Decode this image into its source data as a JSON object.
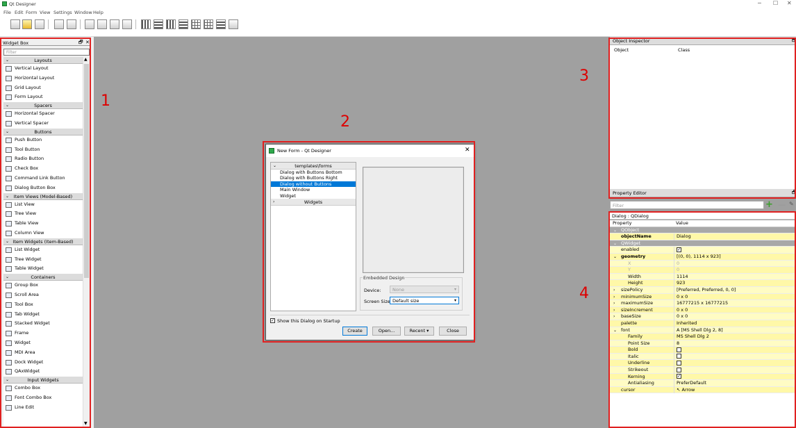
{
  "window": {
    "title": "Qt Designer",
    "min": "─",
    "max": "☐",
    "close": "✕"
  },
  "menu": [
    "File",
    "Edit",
    "Form",
    "View",
    "Settings",
    "Window",
    "Help"
  ],
  "widget_box": {
    "title": "Widget Box",
    "float": "🗗",
    "close": "✕",
    "filter_placeholder": "Filter",
    "rows": [
      {
        "type": "cat",
        "label": "Layouts"
      },
      {
        "type": "item",
        "label": "Vertical Layout",
        "icon": "vertical-layout-icon"
      },
      {
        "type": "item",
        "label": "Horizontal Layout",
        "icon": "horizontal-layout-icon"
      },
      {
        "type": "item",
        "label": "Grid Layout",
        "icon": "grid-layout-icon"
      },
      {
        "type": "item",
        "label": "Form Layout",
        "icon": "form-layout-icon"
      },
      {
        "type": "cat",
        "label": "Spacers"
      },
      {
        "type": "item",
        "label": "Horizontal Spacer",
        "icon": "horizontal-spacer-icon"
      },
      {
        "type": "item",
        "label": "Vertical Spacer",
        "icon": "vertical-spacer-icon"
      },
      {
        "type": "cat",
        "label": "Buttons"
      },
      {
        "type": "item",
        "label": "Push Button",
        "icon": "push-button-icon"
      },
      {
        "type": "item",
        "label": "Tool Button",
        "icon": "tool-button-icon"
      },
      {
        "type": "item",
        "label": "Radio Button",
        "icon": "radio-button-icon"
      },
      {
        "type": "item",
        "label": "Check Box",
        "icon": "check-box-icon"
      },
      {
        "type": "item",
        "label": "Command Link Button",
        "icon": "command-link-icon"
      },
      {
        "type": "item",
        "label": "Dialog Button Box",
        "icon": "dialog-button-box-icon"
      },
      {
        "type": "cat",
        "label": "Item Views (Model-Based)"
      },
      {
        "type": "item",
        "label": "List View",
        "icon": "list-view-icon"
      },
      {
        "type": "item",
        "label": "Tree View",
        "icon": "tree-view-icon"
      },
      {
        "type": "item",
        "label": "Table View",
        "icon": "table-view-icon"
      },
      {
        "type": "item",
        "label": "Column View",
        "icon": "column-view-icon"
      },
      {
        "type": "cat",
        "label": "Item Widgets (Item-Based)"
      },
      {
        "type": "item",
        "label": "List Widget",
        "icon": "list-widget-icon"
      },
      {
        "type": "item",
        "label": "Tree Widget",
        "icon": "tree-widget-icon"
      },
      {
        "type": "item",
        "label": "Table Widget",
        "icon": "table-widget-icon"
      },
      {
        "type": "cat",
        "label": "Containers"
      },
      {
        "type": "item",
        "label": "Group Box",
        "icon": "group-box-icon"
      },
      {
        "type": "item",
        "label": "Scroll Area",
        "icon": "scroll-area-icon"
      },
      {
        "type": "item",
        "label": "Tool Box",
        "icon": "tool-box-icon"
      },
      {
        "type": "item",
        "label": "Tab Widget",
        "icon": "tab-widget-icon"
      },
      {
        "type": "item",
        "label": "Stacked Widget",
        "icon": "stacked-widget-icon"
      },
      {
        "type": "item",
        "label": "Frame",
        "icon": "frame-icon"
      },
      {
        "type": "item",
        "label": "Widget",
        "icon": "widget-icon"
      },
      {
        "type": "item",
        "label": "MDI Area",
        "icon": "mdi-area-icon"
      },
      {
        "type": "item",
        "label": "Dock Widget",
        "icon": "dock-widget-icon"
      },
      {
        "type": "item",
        "label": "QAxWidget",
        "icon": "qaxwidget-icon"
      },
      {
        "type": "cat",
        "label": "Input Widgets"
      },
      {
        "type": "item",
        "label": "Combo Box",
        "icon": "combo-box-icon"
      },
      {
        "type": "item",
        "label": "Font Combo Box",
        "icon": "font-combo-box-icon"
      },
      {
        "type": "item",
        "label": "Line Edit",
        "icon": "line-edit-icon"
      }
    ]
  },
  "dialog": {
    "title": "New Form - Qt Designer",
    "close": "✕",
    "tree_header": "templates\\forms",
    "templates": [
      "Dialog with Buttons Bottom",
      "Dialog with Buttons Right",
      "Dialog without Buttons",
      "Main Window",
      "Widget"
    ],
    "selected_index": 2,
    "widgets_header": "Widgets",
    "embedded_title": "Embedded Design",
    "device_label": "Device:",
    "device_value": "None",
    "screen_label": "Screen Size:",
    "screen_value": "Default size",
    "show_label": "Show this Dialog on Startup",
    "show_checked": "✓",
    "create": "Create",
    "open": "Open...",
    "recent": "Recent",
    "recent_arrow": "▾",
    "close_btn": "Close"
  },
  "object_inspector": {
    "title": "Object Inspector",
    "float": "🗗",
    "col1": "Object",
    "col2": "Class"
  },
  "property_editor": {
    "title": "Property Editor",
    "float": "🗗",
    "filter_placeholder": "Filter",
    "plus": "+",
    "minus": "—",
    "wrench": "✎",
    "object_label": "Dialog : QDialog",
    "rows": [
      {
        "style": "hdr",
        "name": "Property",
        "value": ""
      },
      {
        "style": "grp",
        "name": "QObject",
        "value": "",
        "tw": "⌄"
      },
      {
        "style": "y2",
        "name": "objectName",
        "value": "Dialog",
        "bold": true
      },
      {
        "style": "grp",
        "name": "QWidget",
        "value": "",
        "tw": "⌄"
      },
      {
        "style": "y",
        "name": "enabled",
        "value": "",
        "check": "✓"
      },
      {
        "style": "y2",
        "name": "geometry",
        "value": "[(0, 0), 1114 x 923]",
        "bold": true,
        "tw": "⌄"
      },
      {
        "style": "y dim",
        "name": "X",
        "value": "0",
        "sub": true
      },
      {
        "style": "y2 dim",
        "name": "Y",
        "value": "0",
        "sub": true
      },
      {
        "style": "y",
        "name": "Width",
        "value": "1114",
        "sub": true
      },
      {
        "style": "y2",
        "name": "Height",
        "value": "923",
        "sub": true
      },
      {
        "style": "y",
        "name": "sizePolicy",
        "value": "[Preferred, Preferred, 0, 0]",
        "tw": "›"
      },
      {
        "style": "y2",
        "name": "minimumSize",
        "value": "0 x 0",
        "tw": "›"
      },
      {
        "style": "y",
        "name": "maximumSize",
        "value": "16777215 x 16777215",
        "tw": "›"
      },
      {
        "style": "y2",
        "name": "sizeIncrement",
        "value": "0 x 0",
        "tw": "›"
      },
      {
        "style": "y",
        "name": "baseSize",
        "value": "0 x 0",
        "tw": "›"
      },
      {
        "style": "y2",
        "name": "palette",
        "value": "Inherited"
      },
      {
        "style": "y",
        "name": "font",
        "value": "A  [MS Shell Dlg 2, 8]",
        "tw": "⌄"
      },
      {
        "style": "y2",
        "name": "Family",
        "value": "MS Shell Dlg 2",
        "sub": true
      },
      {
        "style": "y",
        "name": "Point Size",
        "value": "8",
        "sub": true
      },
      {
        "style": "y2",
        "name": "Bold",
        "value": "",
        "sub": true,
        "check": " "
      },
      {
        "style": "y",
        "name": "Italic",
        "value": "",
        "sub": true,
        "check": " "
      },
      {
        "style": "y2",
        "name": "Underline",
        "value": "",
        "sub": true,
        "check": " "
      },
      {
        "style": "y",
        "name": "Strikeout",
        "value": "",
        "sub": true,
        "check": " "
      },
      {
        "style": "y2",
        "name": "Kerning",
        "value": "",
        "sub": true,
        "check": "✓"
      },
      {
        "style": "y",
        "name": "Antialiasing",
        "value": "PreferDefault",
        "sub": true
      },
      {
        "style": "y2",
        "name": "cursor",
        "value": "↖  Arrow"
      }
    ]
  },
  "callouts": [
    "1",
    "2",
    "3",
    "4"
  ],
  "colors": {
    "callout": "#e02020",
    "selection": "#0078d7",
    "property_yellow": "#fffcc4"
  }
}
